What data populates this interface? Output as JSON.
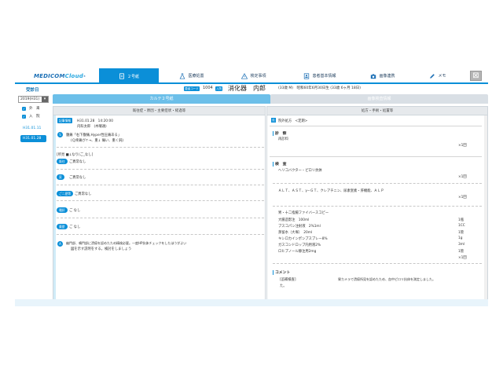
{
  "app": {
    "logo_main": "MEDICOM",
    "logo_cloud": "Cloud",
    "logo_sup": "®"
  },
  "nav": {
    "tabs": [
      {
        "label": "２号紙",
        "icon": "document-icon",
        "active": true
      },
      {
        "label": "医療処置",
        "icon": "flask-icon",
        "active": false
      },
      {
        "label": "検定事項",
        "icon": "warning-icon",
        "active": false
      },
      {
        "label": "患者基本情報",
        "icon": "id-card-icon",
        "active": false
      },
      {
        "label": "画像連携",
        "icon": "camera-icon",
        "active": false
      },
      {
        "label": "メモ",
        "icon": "pen-icon",
        "active": false
      }
    ],
    "close_glyph": "⊠"
  },
  "sidebar": {
    "title": "受診日",
    "date_select": "2019(H31)",
    "date_arrow": "▾",
    "filters": [
      {
        "label": "外　来",
        "checked": true
      },
      {
        "label": "入　院",
        "checked": true
      }
    ],
    "visits": [
      {
        "label": "H31.01.11",
        "selected": false
      },
      {
        "label": "H31.01.28",
        "selected": true
      }
    ]
  },
  "patient": {
    "id_badge": "患者コード",
    "id": "1004",
    "badge2": "入院",
    "name": "消化器　内郎",
    "info": "(33歳 M)　昭和60年6月30日生 (33歳 6ヶ月 18日)"
  },
  "karte_tabs": {
    "active": "カルテ２号紙",
    "inactive": "画像検査情報"
  },
  "left_panel": {
    "header": "既往症・原因・主要症状・経過等",
    "entry_chip": "記事情報",
    "entry_datetime": "H31.01.28　14:20:00",
    "entry_doctor": "内科太郎　(木曜通)",
    "s_circle": "S",
    "s_text1": "腹痛「右下腹痛,Hyper性圧痛ある」",
    "s_text2": "(Ｑ疼痛が↑→、重↓ 痛い、重く鈍)",
    "hx_title": "[所見 ■↓なり(ご_なし]",
    "rows": [
      {
        "chip": "既往",
        "text": "ご異常なし"
      },
      {
        "chip": "家",
        "text": "ご異常なし"
      },
      {
        "chip": "ご二歴等",
        "text": "ご異常なし"
      },
      {
        "chip": "嗜好",
        "text": "ご なし"
      },
      {
        "chip": "薬歴",
        "text": "ご なし"
      }
    ],
    "a_circle": "A",
    "a_text1": "幽門部、噴門部に潰瘍を認めたため精検必要。一度HP抗体チェックをしたほうがよい",
    "a_text2": "図を示す説明をする。検討をしましょう"
  },
  "right_panel": {
    "header": "処方・手術・処置等",
    "rx_icon": "処",
    "rx_title": "院外処方　<定期>",
    "sections": [
      {
        "title": "診　察",
        "lines": [
          "再診料"
        ],
        "qty": [
          "×1回"
        ]
      },
      {
        "title": "検　査",
        "lines": [
          "ヘリコバクター・ピロリ抗体"
        ],
        "qty": [
          "×1回"
        ]
      }
    ],
    "lab_line": "ＡＬＴ、ＡＳＴ、γ−ＧＴ、クレアチニン、尿素窒素・肝機能、ＡＬＰ",
    "lab_qty": "×1回",
    "endo_title": "胃・十二指腸ファイバースコピー",
    "endo_items": [
      {
        "name": "大腸造影注　100ml",
        "qty": "1瓶"
      },
      {
        "name": "ブスコパン注射液　2%1ml",
        "qty": "1CC"
      },
      {
        "name": "蒸留水（大塚）　20ml",
        "qty": "1管"
      },
      {
        "name": "キシロカインポンプスプレー8%",
        "qty": "1g"
      },
      {
        "name": "ガスコンドロップ内用液2%",
        "qty": "3ml"
      },
      {
        "name": "ロヒプノール静注用2mg",
        "qty": "1管"
      },
      {
        "name": "",
        "qty": "×1回"
      }
    ],
    "comment_title": "コメント",
    "comment_tag": "[追補検査]",
    "comment_text": "胃カメラで潰瘍所見を認めたため、血中ピロリ抗体を測定しました。",
    "comment_cont": "た。"
  }
}
